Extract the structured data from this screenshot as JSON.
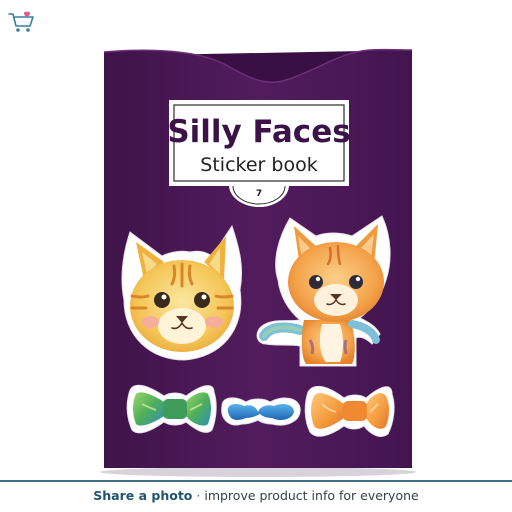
{
  "cart": {
    "icon": "cart-heart-icon"
  },
  "product": {
    "cover_title": "Silly Faces",
    "cover_subtitle": "Sticker book",
    "badge_number": "7",
    "cover_color": "#4d1a58",
    "stickers": [
      "tabby-cat-face-icon",
      "orange-cat-icon",
      "green-bow-tie-icon",
      "blue-mustache-icon",
      "orange-bow-tie-icon"
    ]
  },
  "footer": {
    "cta_label": "Share a photo",
    "separator": "·",
    "text": "improve product info for everyone",
    "accent_color": "#1f5570"
  }
}
